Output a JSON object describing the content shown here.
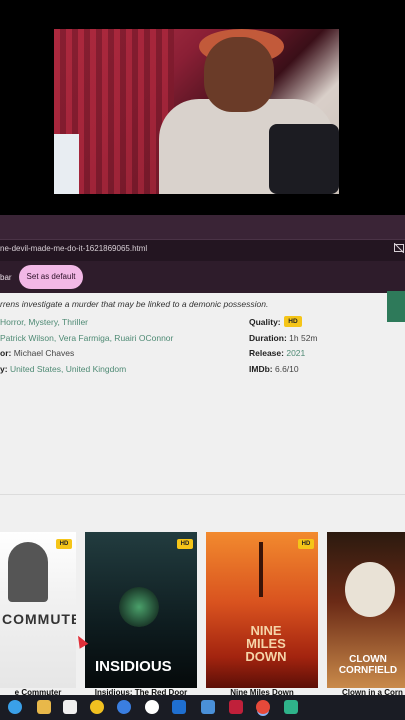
{
  "browser": {
    "url": "ne-devil-made-me-do-it-1621869065.html",
    "infobar_text": "bar",
    "default_button_label": "Set as default"
  },
  "movie": {
    "description": "rrens investigate a murder that may be linked to a demonic possession.",
    "genre": "Horror, Mystery, Thriller",
    "cast": "Patrick Wilson, Vera Farmiga, Ruairi OConnor",
    "director_key": "or:",
    "director": "Michael Chaves",
    "country_key": "y:",
    "country": "United States, United Kingdom",
    "quality_key": "Quality:",
    "quality": "HD",
    "duration_key": "Duration:",
    "duration": "1h 52m",
    "release_key": "Release:",
    "release": "2021",
    "imdb_key": "IMDb:",
    "imdb": "6.6/10"
  },
  "related": [
    {
      "title": "e Commuter",
      "badge": "HD",
      "poster_text": "COMMUTER"
    },
    {
      "title": "Insidious: The Red Door",
      "badge": "HD",
      "poster_text": "INSIDIOUS"
    },
    {
      "title": "Nine Miles Down",
      "badge": "HD",
      "poster_text": "NINE MILES DOWN"
    },
    {
      "title": "Clown in a Corn",
      "badge": "",
      "poster_text": "CLOWN CORNFIELD"
    }
  ],
  "icons": {
    "cast": "cast-off-icon",
    "taskbar": [
      "windows-start-icon",
      "task-view-icon",
      "file-explorer-icon",
      "microsoft-store-icon",
      "norton-icon",
      "edge-icon",
      "github-icon",
      "outlook-icon",
      "f-app-icon",
      "tf-app-icon",
      "chrome-icon",
      "messenger-icon"
    ]
  },
  "colors": {
    "accent_pink": "#f2b8e6",
    "hd_badge": "#f5c518",
    "link_green": "#4e8a74",
    "chrome_bg": "#3a2436"
  }
}
